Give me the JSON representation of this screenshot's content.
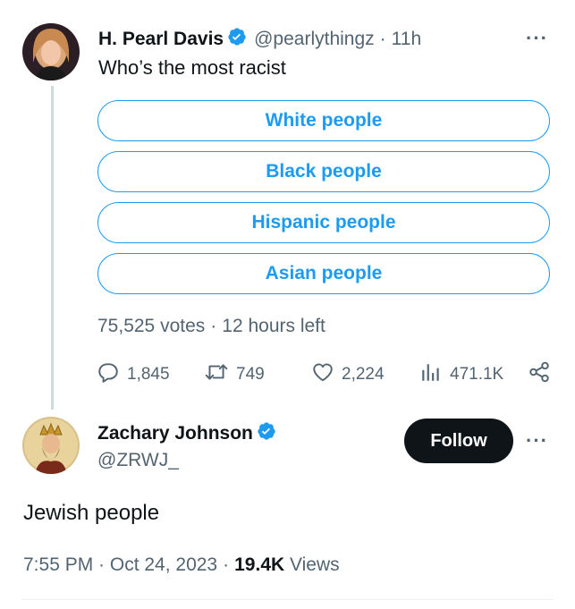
{
  "original_tweet": {
    "display_name": "H. Pearl Davis",
    "handle": "@pearlythingz",
    "separator": "·",
    "age": "11h",
    "text": "Who’s the most racist",
    "more_label": "···",
    "poll": {
      "options": [
        "White people",
        "Black people",
        "Hispanic people",
        "Asian people"
      ],
      "votes": "75,525 votes",
      "separator": "·",
      "time_left": "12 hours left"
    },
    "actions": {
      "replies": "1,845",
      "retweets": "749",
      "likes": "2,224",
      "views": "471.1K"
    }
  },
  "reply_tweet": {
    "display_name": "Zachary Johnson",
    "handle": "@ZRWJ_",
    "follow_label": "Follow",
    "more_label": "···",
    "text": "Jewish people",
    "timestamp": "7:55 PM · Oct 24, 2023",
    "separator": "·",
    "views_count": "19.4K",
    "views_label": "Views"
  },
  "colors": {
    "accent": "#1d9bf0",
    "text_primary": "#0f1419",
    "text_secondary": "#536471",
    "thread_line": "#cfd9de"
  },
  "icons": [
    "reply-icon",
    "retweet-icon",
    "like-icon",
    "views-icon",
    "share-icon",
    "verified-badge-icon"
  ]
}
